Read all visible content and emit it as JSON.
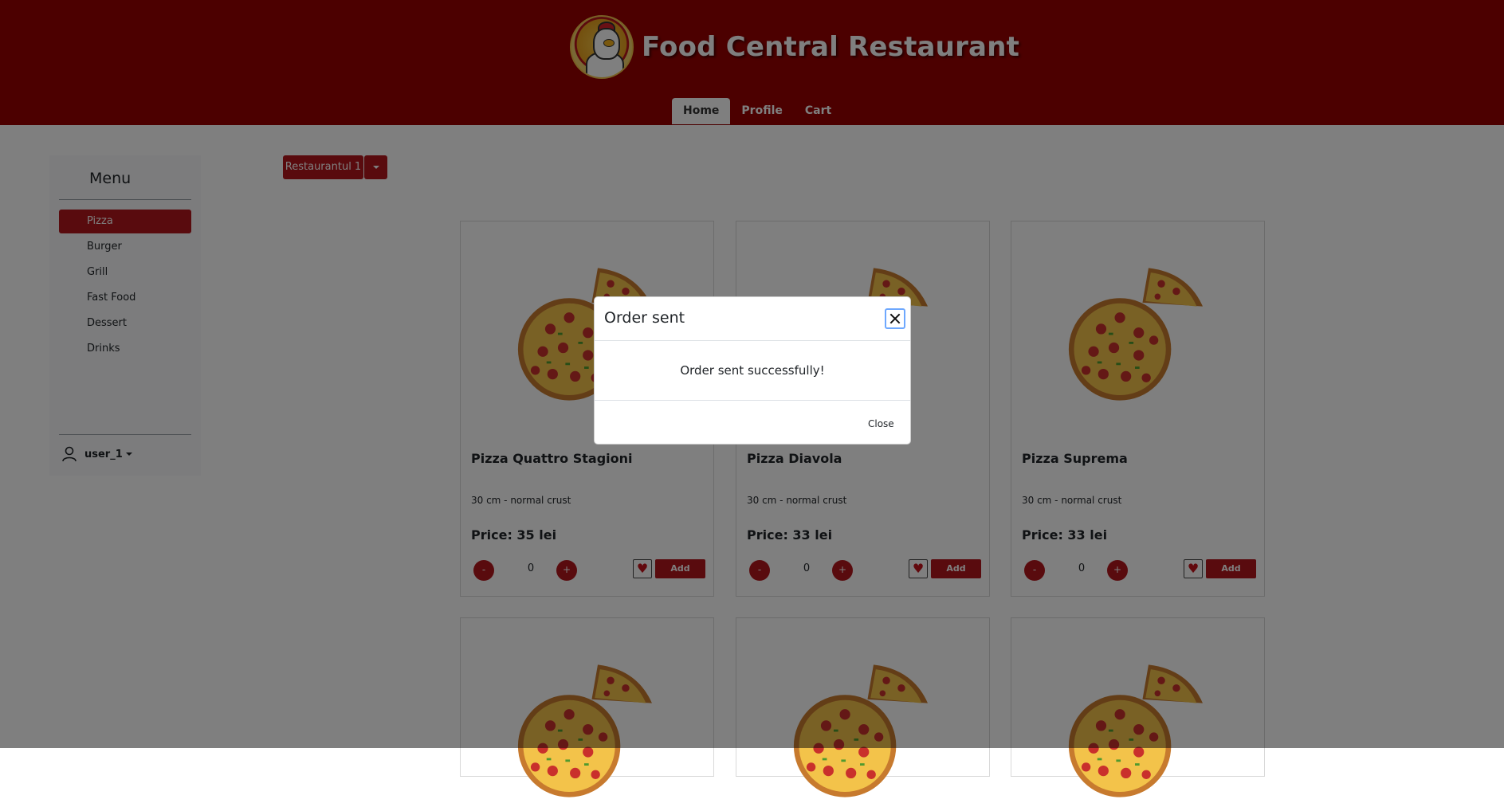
{
  "header": {
    "title": "Food Central Restaurant",
    "nav": [
      {
        "label": "Home",
        "active": true
      },
      {
        "label": "Profile",
        "active": false
      },
      {
        "label": "Cart",
        "active": false
      }
    ]
  },
  "sidebar": {
    "title": "Menu",
    "items": [
      {
        "label": "Pizza",
        "active": true
      },
      {
        "label": "Burger"
      },
      {
        "label": "Grill"
      },
      {
        "label": "Fast Food"
      },
      {
        "label": "Dessert"
      },
      {
        "label": "Drinks"
      }
    ],
    "user": "user_1"
  },
  "restaurant_select": {
    "label": "Restaurantul 1"
  },
  "products": [
    {
      "name": "Pizza Quattro Stagioni",
      "desc": "30 cm - normal crust",
      "price": "Price: 35 lei",
      "qty": "0",
      "add_label": "Add",
      "minus": "-",
      "plus": "+"
    },
    {
      "name": "Pizza Diavola",
      "desc": "30 cm - normal crust",
      "price": "Price: 33 lei",
      "qty": "0",
      "add_label": "Add",
      "minus": "-",
      "plus": "+"
    },
    {
      "name": "Pizza Suprema",
      "desc": "30 cm - normal crust",
      "price": "Price: 33 lei",
      "qty": "0",
      "add_label": "Add",
      "minus": "-",
      "plus": "+"
    }
  ],
  "modal": {
    "title": "Order sent",
    "body": "Order sent successfully!",
    "close_label": "Close"
  },
  "colors": {
    "brand": "#990000",
    "accent": "#b3161c",
    "overlay": "rgba(0,0,0,0.5)"
  }
}
